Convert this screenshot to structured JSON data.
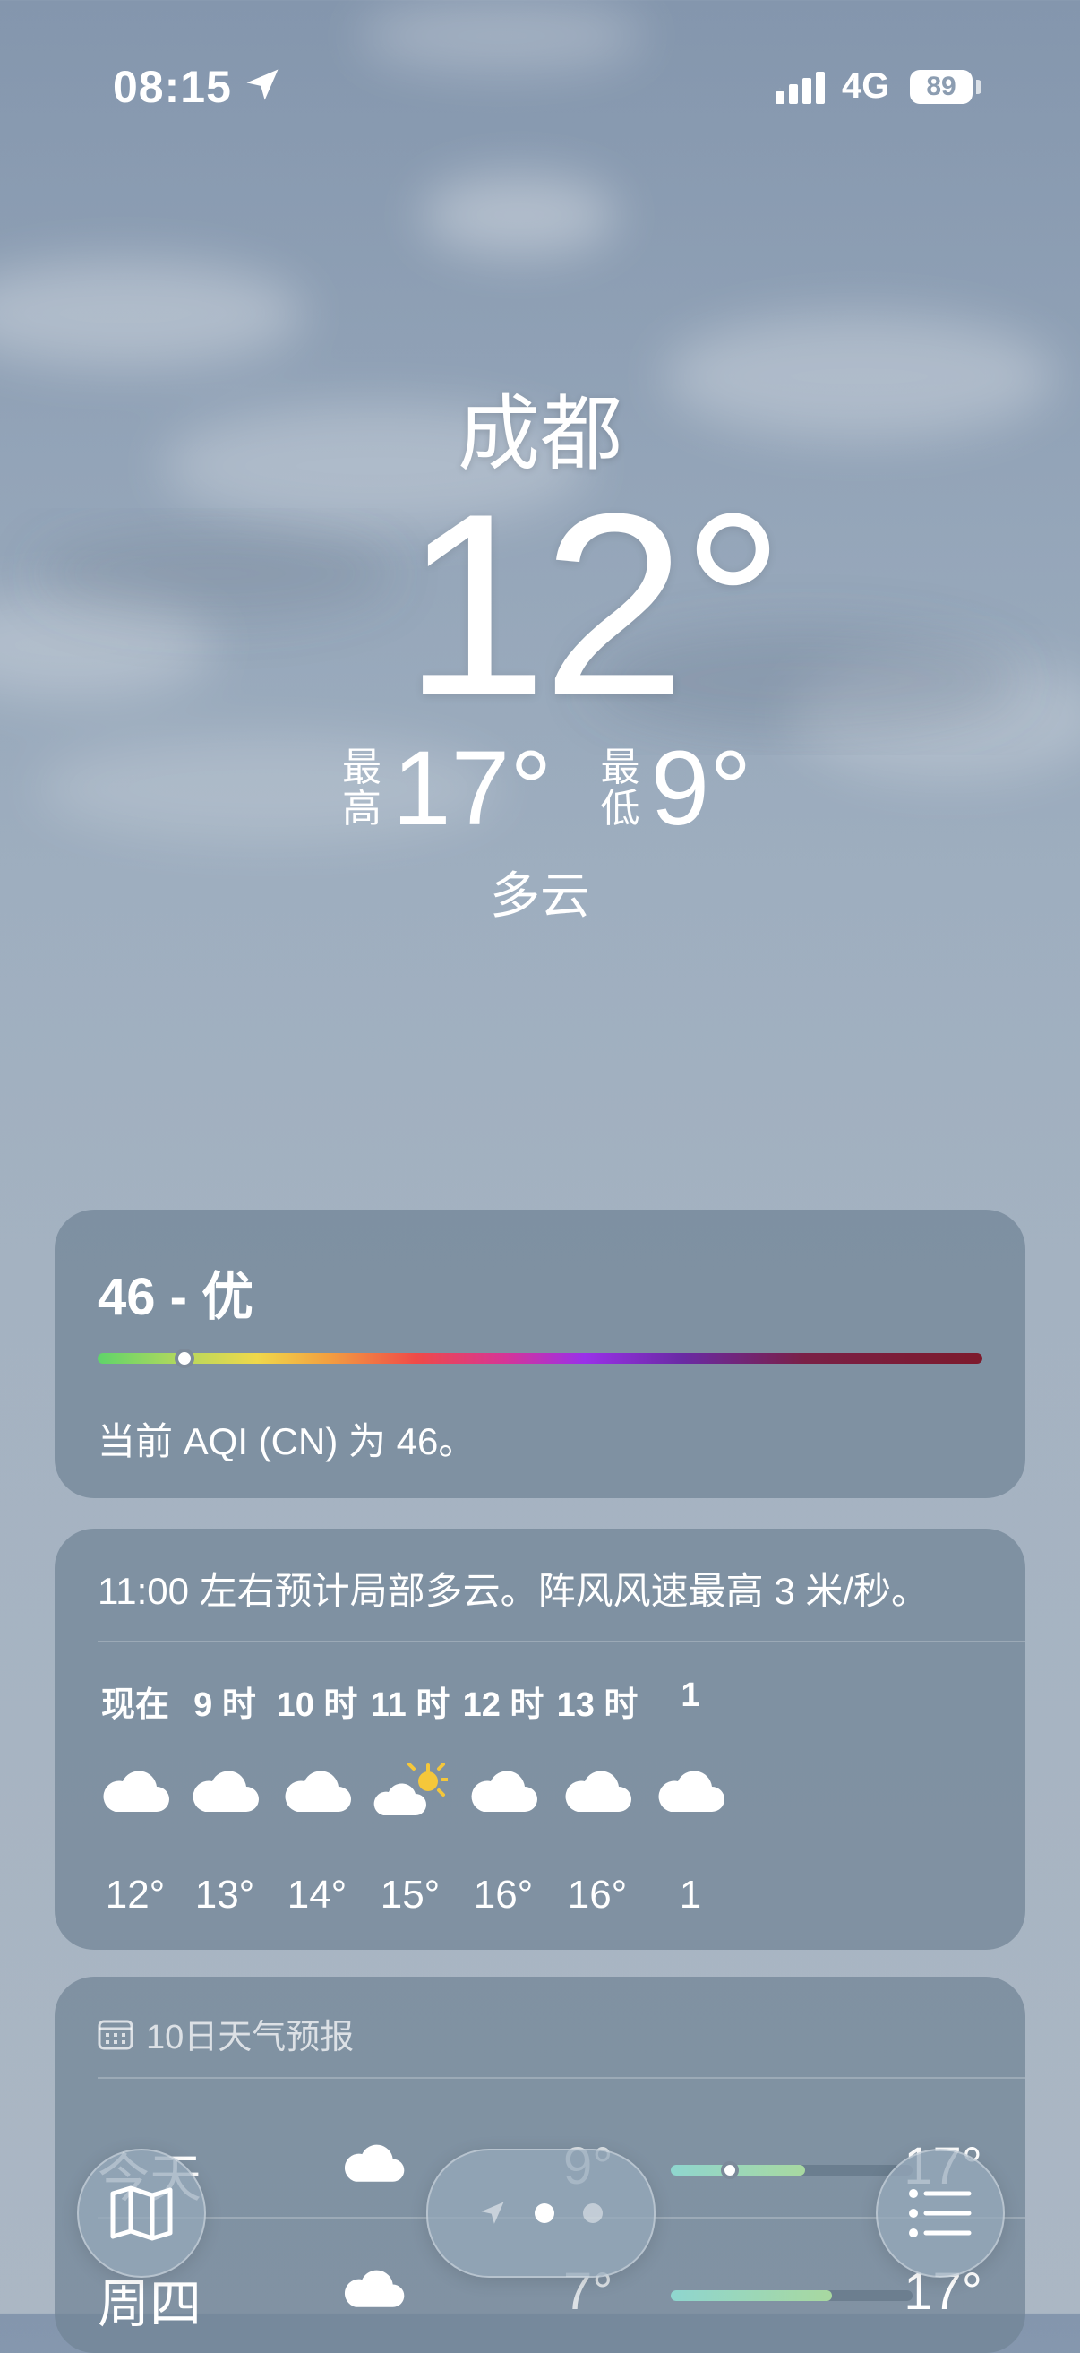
{
  "status_bar": {
    "time": "08:15",
    "network": "4G",
    "battery": "89"
  },
  "hero": {
    "city": "成都",
    "temperature": "12°",
    "high_label": [
      "最",
      "高"
    ],
    "high": "17°",
    "low_label": [
      "最",
      "低"
    ],
    "low": "9°",
    "condition": "多云"
  },
  "aqi": {
    "title": "46 - 优",
    "value": 46,
    "description": "当前 AQI (CN) 为 46。"
  },
  "hourly": {
    "summary": "11:00 左右预计局部多云。阵风风速最高 3 米/秒。",
    "hours": [
      {
        "label": "现在",
        "icon": "cloud-icon",
        "temp": "12°"
      },
      {
        "label": "9 时",
        "icon": "cloud-icon",
        "temp": "13°"
      },
      {
        "label": "10 时",
        "icon": "cloud-icon",
        "temp": "14°"
      },
      {
        "label": "11 时",
        "icon": "partly-sunny-icon",
        "temp": "15°"
      },
      {
        "label": "12 时",
        "icon": "cloud-icon",
        "temp": "16°"
      },
      {
        "label": "13 时",
        "icon": "cloud-icon",
        "temp": "16°"
      },
      {
        "label": "1",
        "icon": "cloud-icon",
        "temp": "1"
      }
    ]
  },
  "forecast": {
    "header": "10日天气预报",
    "days": [
      {
        "day": "今天",
        "icon": "cloud-icon",
        "low": "9°",
        "high": "17°"
      },
      {
        "day": "周四",
        "icon": "cloud-icon",
        "low": "7°",
        "high": "17°"
      }
    ]
  },
  "colors": {
    "accent_sun": "#f5c73a",
    "aqi_good": "#5fd46a"
  }
}
